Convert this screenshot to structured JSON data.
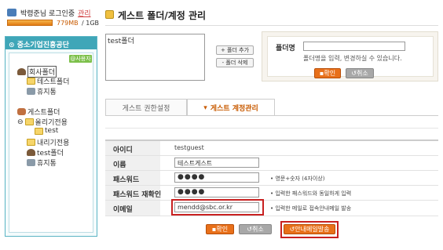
{
  "user": {
    "name": "박령준님 로그인중",
    "manage_label": "관리",
    "quota_used": "779MB",
    "quota_total": "/ 1GB"
  },
  "tree": {
    "org_name": "중소기업진흥공단",
    "admin_badge": "@사용자메",
    "nodes": [
      {
        "label": "회사폴더",
        "icon": "company-folder-icon"
      },
      {
        "label": "테스트폴더",
        "icon": "folder-icon"
      },
      {
        "label": "휴지통",
        "icon": "trash-icon"
      },
      {
        "label": "게스트폴더",
        "icon": "guest-icon"
      },
      {
        "label": "올리기전용",
        "icon": "upload-folder-icon"
      },
      {
        "label": "test",
        "icon": "folder-icon"
      },
      {
        "label": "내리기전용",
        "icon": "download-folder-icon"
      },
      {
        "label": "test폴더",
        "icon": "guest-folder-icon"
      },
      {
        "label": "휴지통",
        "icon": "trash-icon"
      }
    ]
  },
  "page": {
    "title": "게스트 폴더/계정 관리"
  },
  "folder_list": {
    "items": [
      "test폴더"
    ]
  },
  "folder_buttons": {
    "add": "+ 폴더 추가",
    "delete": "- 폴더 삭제"
  },
  "folder_name": {
    "label": "폴더명",
    "value": "",
    "help": "폴더명을 입력, 변경하실 수 있습니다.",
    "confirm": "확인",
    "cancel": "취소"
  },
  "tabs": [
    {
      "label": "게스트 권한설정",
      "active": false
    },
    {
      "label": "게스트 계정관리",
      "active": true
    }
  ],
  "account_form": {
    "id_label": "아이디",
    "id_value": "testguest",
    "name_label": "이름",
    "name_value": "테스트게스트",
    "pw_label": "패스워드",
    "pw_value": "●●●●",
    "pw_hint": "• 영문+숫자 (4자이상)",
    "pw2_label": "패스워드 재확인",
    "pw2_value": "●●●●",
    "pw2_hint": "• 입력한 패스워드와 동일하게 입력",
    "email_label": "이메일",
    "email_value": "mendd@sbc.or.kr",
    "email_hint": "• 입력한 메일로 접속안내메일 발송"
  },
  "actions": {
    "confirm": "확인",
    "cancel": "취소",
    "send_mail": "안내메일발송"
  },
  "colors": {
    "accent": "#e8701a",
    "panel": "#3fa6b8",
    "highlight": "#c82020"
  }
}
